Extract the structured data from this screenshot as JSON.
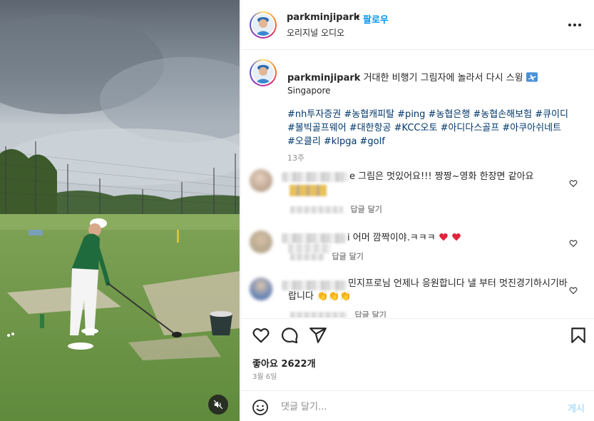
{
  "post": {
    "username": "parkminjipark",
    "follow_label": "팔로우",
    "audio": "오리지널 오디오",
    "separator": "•",
    "caption": "거대한 비행기 그림자에 놀라서 다시 스윙",
    "caption_emoji": "airplane-icon",
    "location": "Singapore",
    "hashtags": "#nh투자증권 #농협캐피탈 #ping #농협은행 #농협손해보험 #큐이디 #볼빅골프웨어 #대한항공 #KCC오토 #아디다스골프 #아쿠아쉬네트 #오클리 #klpga #golf",
    "time_ago": "13주"
  },
  "comments": [
    {
      "text": "e 그림은 멋있어요!!! 짱짱~영화 한장면 같아요",
      "reply": "답글 달기"
    },
    {
      "text": "i 어머 깜짝이야.ㅋㅋㅋ",
      "reply": "답글 달기"
    },
    {
      "text": "민지프로님 언제나 응원합니다 낼 부터 멋진경기하시기바랍니다",
      "reply": "답글 달기"
    }
  ],
  "likes": "좋아요 2622개",
  "date": "3월 6일",
  "comment_box": {
    "placeholder": "댓글 달기...",
    "post_label": "게시"
  },
  "colors": {
    "link": "#00376b",
    "follow": "#0095f6",
    "post_disabled": "#b2dffc",
    "muted": "#8e8e8e"
  }
}
